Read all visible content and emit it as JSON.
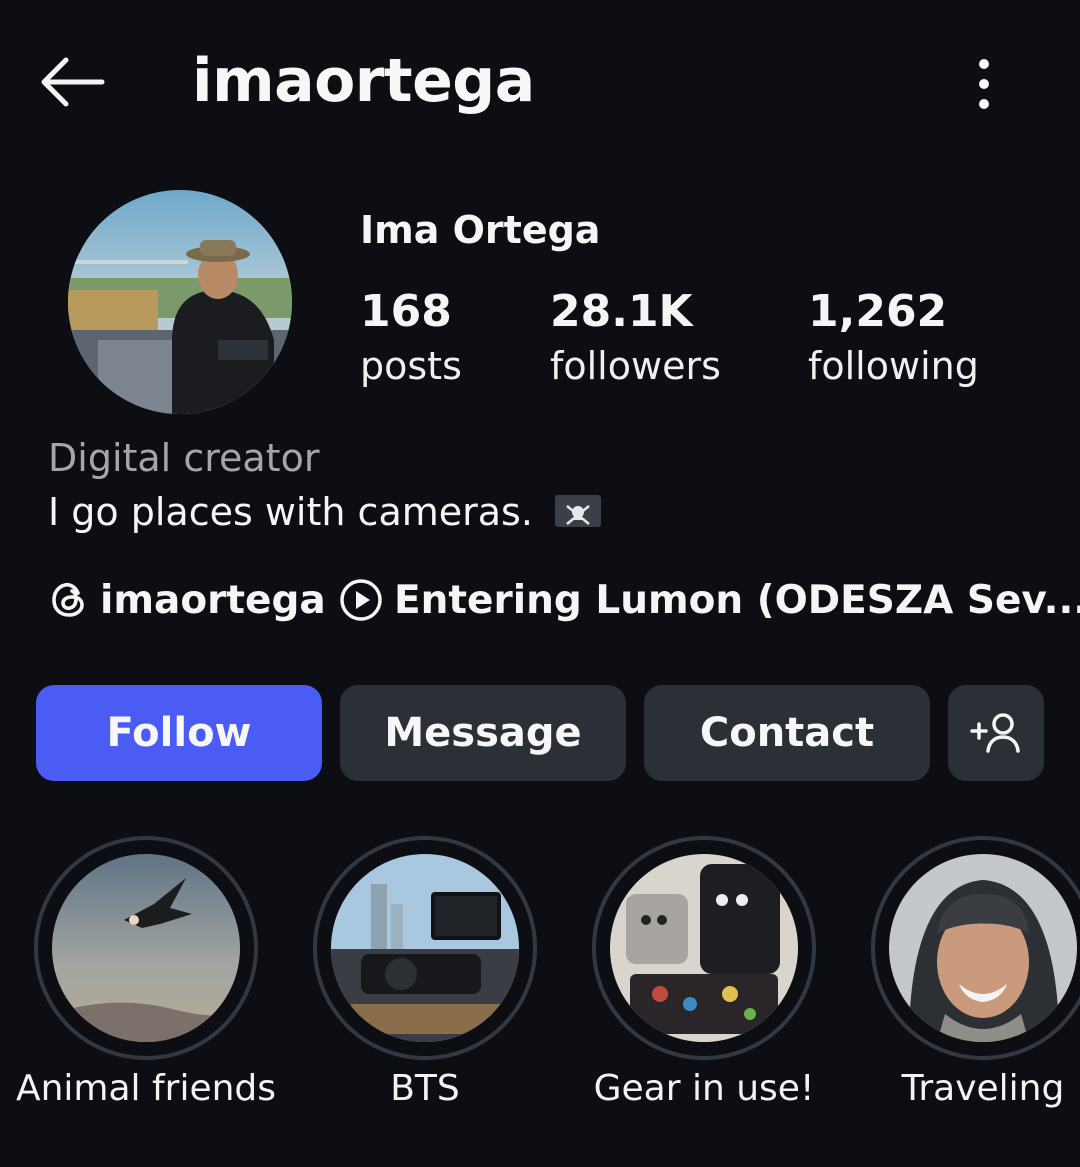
{
  "header": {
    "username": "imaortega",
    "back_icon": "arrow-left-icon",
    "more_icon": "more-vertical-icon"
  },
  "profile": {
    "full_name": "Ima Ortega",
    "stats": {
      "posts": {
        "value": "168",
        "label": "posts"
      },
      "followers": {
        "value": "28.1K",
        "label": "followers"
      },
      "following": {
        "value": "1,262",
        "label": "following"
      }
    },
    "category": "Digital creator",
    "bio": "I go places with cameras.",
    "bio_emoji": "pirate-flag-icon",
    "threads_handle": "imaortega",
    "music_track": "Entering Lumon (ODESZA Sev..."
  },
  "actions": {
    "follow": "Follow",
    "message": "Message",
    "contact": "Contact",
    "add_user_icon": "add-user-icon"
  },
  "highlights": [
    {
      "label": "Animal friends"
    },
    {
      "label": "BTS"
    },
    {
      "label": "Gear in use!"
    },
    {
      "label": "Traveling"
    }
  ],
  "colors": {
    "background": "#0c0e14",
    "primary_button": "#4a5cf4",
    "secondary_button": "#2b2f36",
    "muted_text": "#a3a6ad"
  }
}
